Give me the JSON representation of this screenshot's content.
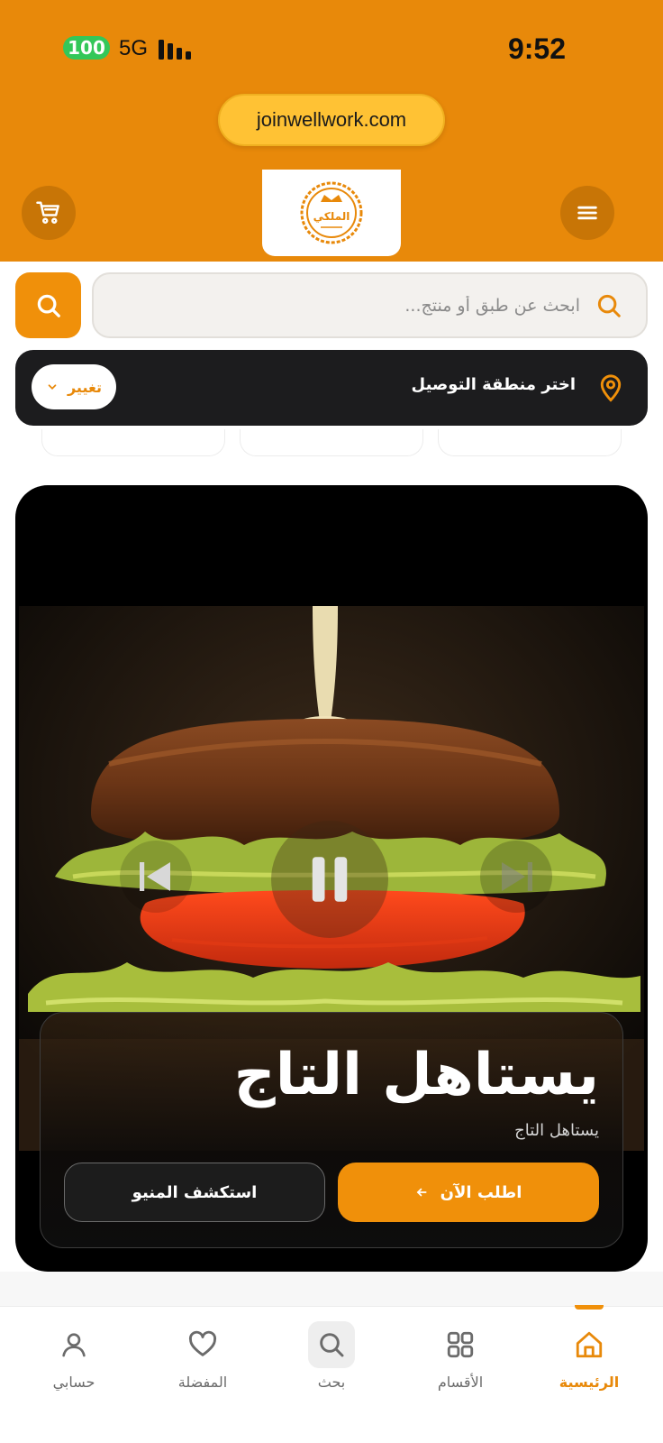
{
  "status_bar": {
    "battery": "100",
    "network": "5G",
    "time": "9:52"
  },
  "browser": {
    "url": "joinwellwork.com"
  },
  "header": {
    "logo_text": "الملكي",
    "cart_icon": "cart-icon",
    "menu_icon": "hamburger-icon"
  },
  "search": {
    "placeholder": "ابحث عن طبق أو منتج...",
    "value": ""
  },
  "delivery": {
    "label": "اختر منطقة التوصيل",
    "change_label": "تغيير"
  },
  "hero": {
    "title": "يستاهل التاج",
    "subtitle": "يستاهل التاج",
    "order_label": "اطلب الآن",
    "explore_label": "استكشف المنيو"
  },
  "bottom_nav": {
    "items": [
      {
        "label": "الرئيسية",
        "icon": "home-icon",
        "active": true
      },
      {
        "label": "الأقسام",
        "icon": "grid-icon",
        "active": false
      },
      {
        "label": "بحث",
        "icon": "search-icon",
        "active": false
      },
      {
        "label": "المفضلة",
        "icon": "heart-icon",
        "active": false
      },
      {
        "label": "حسابي",
        "icon": "user-icon",
        "active": false
      }
    ]
  },
  "colors": {
    "brand": "#E8890A",
    "accent": "#F0900A",
    "dark": "#1C1C1E",
    "battery": "#34C759"
  }
}
